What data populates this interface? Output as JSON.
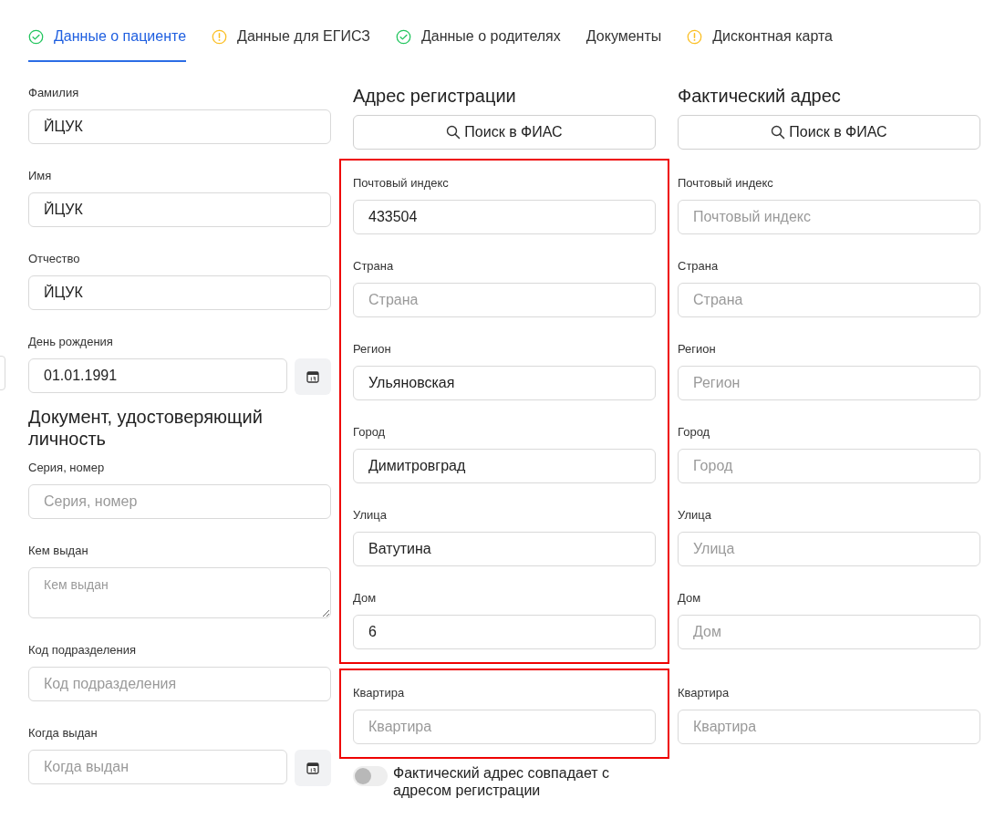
{
  "tabs": [
    {
      "label": "Данные о пациенте",
      "kind": "ok",
      "selected": true
    },
    {
      "label": "Данные для ЕГИСЗ",
      "kind": "warning",
      "selected": false
    },
    {
      "label": "Данные о родителях",
      "kind": "ok",
      "selected": false
    },
    {
      "label": "Документы",
      "kind": "plain",
      "selected": false
    },
    {
      "label": "Дисконтная карта",
      "kind": "warning",
      "selected": false
    }
  ],
  "patient": {
    "fields": [
      {
        "kind": "text",
        "label": "Фамилия",
        "value": "ЙЦУК"
      },
      {
        "kind": "text",
        "label": "Имя",
        "value": "ЙЦУК"
      },
      {
        "kind": "text",
        "label": "Отчество",
        "value": "ЙЦУК"
      },
      {
        "kind": "date",
        "label": "День рождения",
        "value": "01.01.1991"
      }
    ]
  },
  "document": {
    "title": "Документ, удостоверяющий личность",
    "fields": [
      {
        "kind": "text",
        "label": "Серия, номер",
        "placeholder": "Серия, номер"
      },
      {
        "kind": "textarea",
        "label": "Кем выдан",
        "placeholder": "Кем выдан"
      },
      {
        "kind": "text",
        "label": "Код подразделения",
        "placeholder": "Код подразделения"
      },
      {
        "kind": "date",
        "label": "Когда выдан",
        "placeholder": "Когда выдан"
      }
    ]
  },
  "addresses": [
    {
      "title": "Адрес регистрации",
      "search_button": "Поиск в ФИАС",
      "groups": [
        {
          "highlighted": true,
          "fields": [
            {
              "label": "Почтовый индекс",
              "value": "433504"
            },
            {
              "label": "Страна",
              "placeholder": "Страна"
            },
            {
              "label": "Регион",
              "value": "Ульяновская"
            },
            {
              "label": "Город",
              "value": "Димитровград"
            },
            {
              "label": "Улица",
              "value": "Ватутина"
            },
            {
              "label": "Дом",
              "value": "6"
            }
          ]
        },
        {
          "highlighted": true,
          "fields": [
            {
              "label": "Квартира",
              "placeholder": "Квартира"
            }
          ]
        }
      ],
      "same_address_toggle": {
        "label": "Фактический адрес совпадает с адресом регистрации",
        "on": false
      }
    },
    {
      "title": "Фактический адрес",
      "search_button": "Поиск в ФИАС",
      "groups": [
        {
          "fields": [
            {
              "label": "Почтовый индекс",
              "placeholder": "Почтовый индекс"
            },
            {
              "label": "Страна",
              "placeholder": "Страна"
            },
            {
              "label": "Регион",
              "placeholder": "Регион"
            },
            {
              "label": "Город",
              "placeholder": "Город"
            },
            {
              "label": "Улица",
              "placeholder": "Улица"
            },
            {
              "label": "Дом",
              "placeholder": "Дом"
            }
          ]
        },
        {
          "fields": [
            {
              "label": "Квартира",
              "placeholder": "Квартира"
            }
          ]
        }
      ]
    }
  ]
}
